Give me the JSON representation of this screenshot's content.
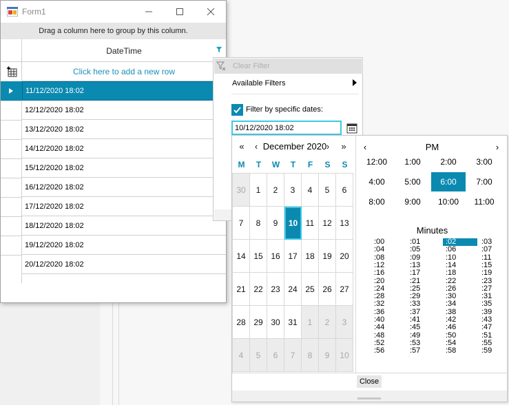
{
  "window": {
    "title": "Form1"
  },
  "grid": {
    "group_panel_text": "Drag a column here to group by this column.",
    "column_header": "DateTime",
    "new_row_text": "Click here to add a new row",
    "rows": [
      "11/12/2020 18:02",
      "12/12/2020 18:02",
      "13/12/2020 18:02",
      "14/12/2020 18:02",
      "15/12/2020 18:02",
      "16/12/2020 18:02",
      "17/12/2020 18:02",
      "18/12/2020 18:02",
      "19/12/2020 18:02",
      "20/12/2020 18:02"
    ],
    "selected_row": 0
  },
  "filter": {
    "clear_filter": "Clear Filter",
    "available_filters": "Available Filters",
    "specific_dates_label": "Filter by specific dates:",
    "specific_dates_checked": true,
    "date_value": "10/12/2020 18:02"
  },
  "calendar": {
    "prev_year": "«",
    "prev_month": "‹",
    "month_title": "December 2020",
    "next_month": "›",
    "next_year": "»",
    "weekdays": [
      "M",
      "T",
      "W",
      "T",
      "F",
      "S",
      "S"
    ],
    "weeks": [
      [
        "30",
        "1",
        "2",
        "3",
        "4",
        "5",
        "6"
      ],
      [
        "7",
        "8",
        "9",
        "10",
        "11",
        "12",
        "13"
      ],
      [
        "14",
        "15",
        "16",
        "17",
        "18",
        "19",
        "20"
      ],
      [
        "21",
        "22",
        "23",
        "24",
        "25",
        "26",
        "27"
      ],
      [
        "28",
        "29",
        "30",
        "31",
        "1",
        "2",
        "3"
      ],
      [
        "4",
        "5",
        "6",
        "7",
        "8",
        "9",
        "10"
      ]
    ],
    "other_month": [
      [
        0
      ],
      [],
      [],
      [],
      [
        4,
        5,
        6
      ],
      [
        0,
        1,
        2,
        3,
        4,
        5,
        6
      ]
    ],
    "selected_day": "10"
  },
  "clock": {
    "period": "PM",
    "prev": "‹",
    "next": "›",
    "hours": [
      "12:00",
      "1:00",
      "2:00",
      "3:00",
      "4:00",
      "5:00",
      "6:00",
      "7:00",
      "8:00",
      "9:00",
      "10:00",
      "11:00"
    ],
    "selected_hour": "6:00",
    "minutes_title": "Minutes",
    "minutes": [
      ":00",
      ":01",
      ":02",
      ":03",
      ":04",
      ":05",
      ":06",
      ":07",
      ":08",
      ":09",
      ":10",
      ":11",
      ":12",
      ":13",
      ":14",
      ":15",
      ":16",
      ":17",
      ":18",
      ":19",
      ":20",
      ":21",
      ":22",
      ":23",
      ":24",
      ":25",
      ":26",
      ":27",
      ":28",
      ":29",
      ":30",
      ":31",
      ":32",
      ":33",
      ":34",
      ":35",
      ":36",
      ":37",
      ":38",
      ":39",
      ":40",
      ":41",
      ":42",
      ":43",
      ":44",
      ":45",
      ":46",
      ":47",
      ":48",
      ":49",
      ":50",
      ":51",
      ":52",
      ":53",
      ":54",
      ":55",
      ":56",
      ":57",
      ":58",
      ":59"
    ],
    "selected_minute": ":02"
  },
  "popup": {
    "close_label": "Close"
  },
  "colors": {
    "accent": "#0a8ab0",
    "focus": "#3cc8e6",
    "link": "#1a8fb8"
  }
}
